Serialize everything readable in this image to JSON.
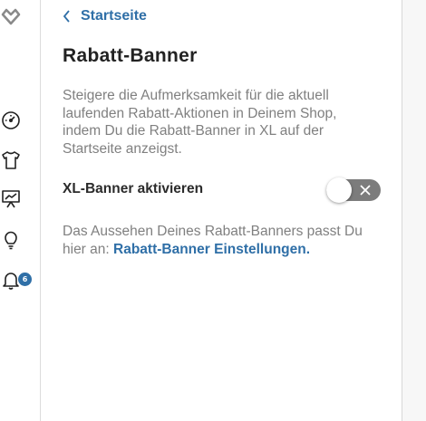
{
  "header": {
    "back_label": "Startseite"
  },
  "main": {
    "title": "Rabatt-Banner",
    "description": "Steigere die Aufmerksamkeit für die aktuell laufenden Rabatt-Aktionen in Deinem Shop, indem Du die Rabatt-Banner in XL auf der Startseite anzeigst.",
    "toggle_label": "XL-Banner aktivieren",
    "toggle_state": "off",
    "info_text": "Das Aussehen Deines Rabatt-Banners passt Du hier an: ",
    "info_link": "Rabatt-Banner Einstellungen."
  },
  "sidebar": {
    "icons": [
      "heart-logo-icon",
      "dashboard-gauge-icon",
      "shirt-icon",
      "presentation-chart-icon",
      "lightbulb-icon",
      "bell-icon"
    ],
    "notification_count": "6"
  },
  "colors": {
    "accent": "#2f6fa7",
    "toggle_track": "#7c7c7c",
    "text_muted": "#808080"
  }
}
